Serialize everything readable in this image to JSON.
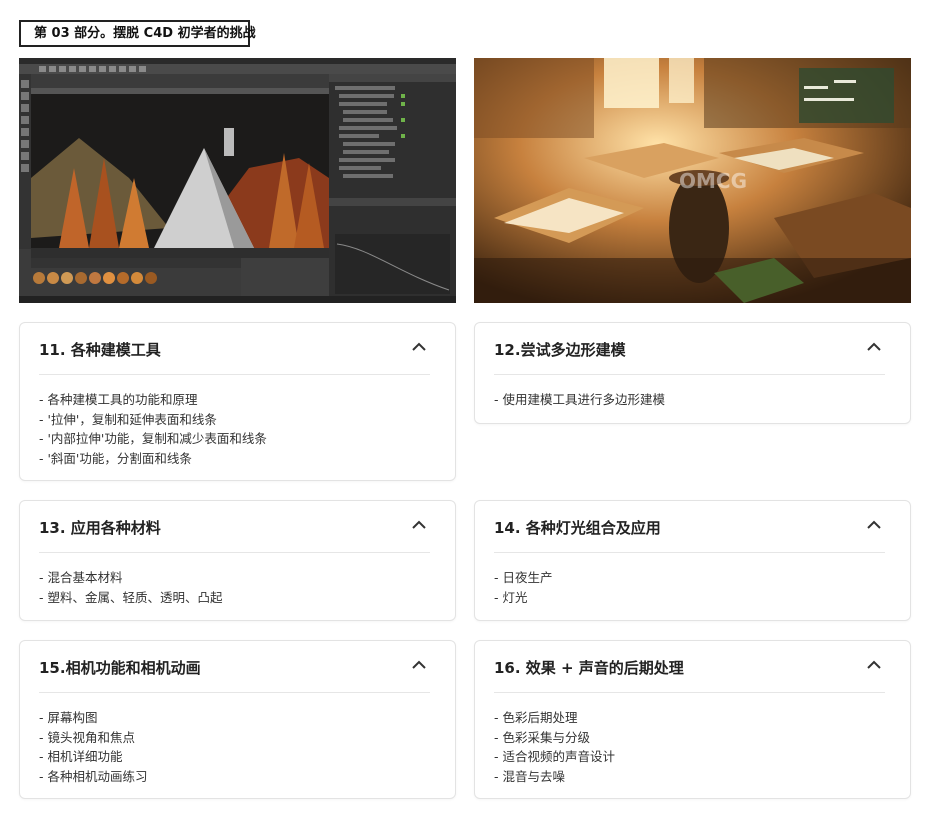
{
  "section_tag": "第 03 部分。摆脱 C4D 初学者的挑战",
  "screenshot_watermark": "OMCG",
  "cards": [
    {
      "title": "11. 各种建模工具",
      "items": [
        "- 各种建模工具的功能和原理",
        "- '拉伸'，复制和延伸表面和线条",
        "- '内部拉伸'功能，复制和减少表面和线条",
        "- '斜面'功能，分割面和线条"
      ]
    },
    {
      "title": "12.尝试多边形建模",
      "items": [
        "- 使用建模工具进行多边形建模"
      ]
    },
    {
      "title": "13. 应用各种材料",
      "items": [
        "- 混合基本材料",
        "- 塑料、金属、轻质、透明、凸起"
      ]
    },
    {
      "title": "14. 各种灯光组合及应用",
      "items": [
        "- 日夜生产",
        "- 灯光"
      ]
    },
    {
      "title": "15.相机功能和相机动画",
      "items": [
        "- 屏幕构图",
        "- 镜头视角和焦点",
        "- 相机详细功能",
        "- 各种相机动画练习"
      ]
    },
    {
      "title": "16. 效果 + 声音的后期处理",
      "items": [
        "- 色彩后期处理",
        "- 色彩采集与分级",
        "- 适合视频的声音设计",
        "- 混音与去噪"
      ]
    }
  ]
}
